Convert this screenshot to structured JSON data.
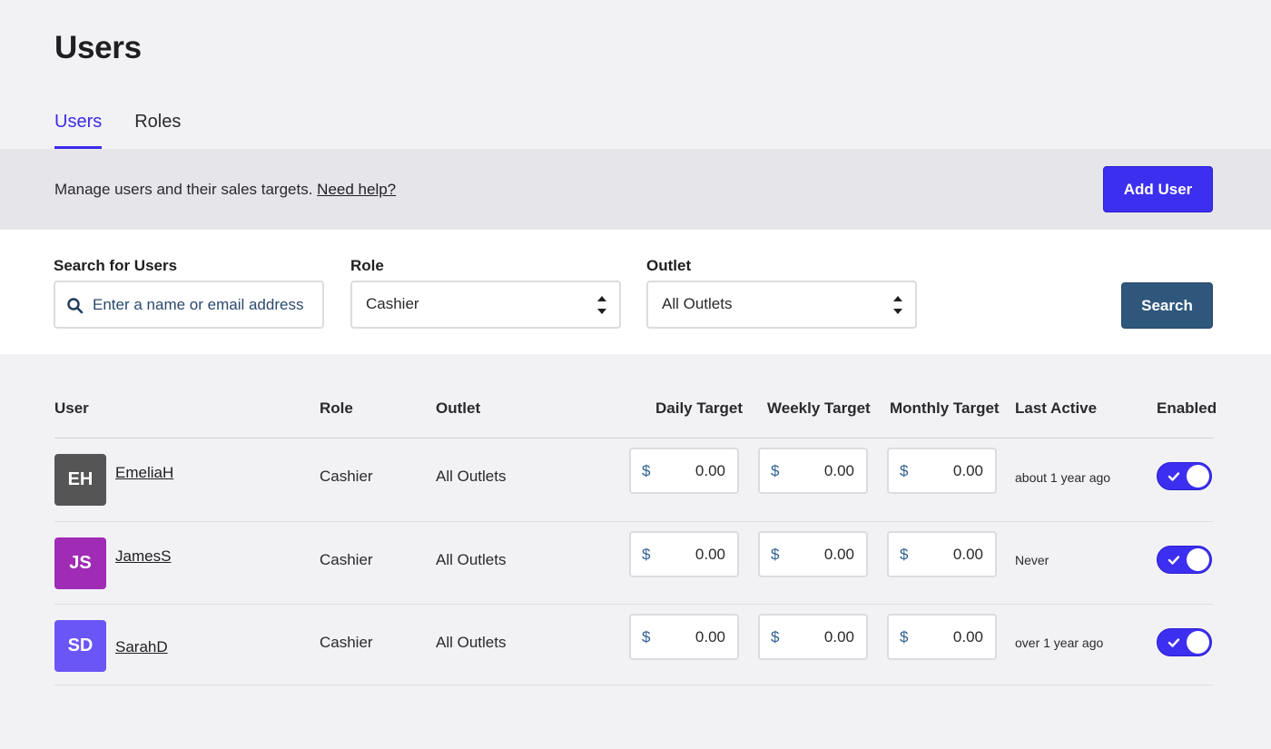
{
  "page": {
    "title": "Users"
  },
  "tabs": [
    {
      "label": "Users",
      "active": true
    },
    {
      "label": "Roles",
      "active": false
    }
  ],
  "banner": {
    "text": "Manage users and their sales targets.",
    "help_link": "Need help?",
    "add_button": "Add User"
  },
  "filters": {
    "search_label": "Search for Users",
    "search_placeholder": "Enter a name or email address",
    "role_label": "Role",
    "role_value": "Cashier",
    "outlet_label": "Outlet",
    "outlet_value": "All Outlets",
    "search_button": "Search"
  },
  "table": {
    "headers": {
      "user": "User",
      "role": "Role",
      "outlet": "Outlet",
      "daily": "Daily Target",
      "weekly": "Weekly Target",
      "monthly": "Monthly Target",
      "last_active": "Last Active",
      "enabled": "Enabled"
    },
    "currency": "$",
    "rows": [
      {
        "initials": "EH",
        "avatar_color": "#555555",
        "name": "EmeliaH",
        "role": "Cashier",
        "outlet": "All Outlets",
        "daily": "0.00",
        "weekly": "0.00",
        "monthly": "0.00",
        "last_active": "about 1 year ago",
        "enabled": true
      },
      {
        "initials": "JS",
        "avatar_color": "#a02bb5",
        "name": "JamesS",
        "role": "Cashier",
        "outlet": "All Outlets",
        "daily": "0.00",
        "weekly": "0.00",
        "monthly": "0.00",
        "last_active": "Never",
        "enabled": true
      },
      {
        "initials": "SD",
        "avatar_color": "#6a55f5",
        "name": "SarahD",
        "role": "Cashier",
        "outlet": "All Outlets",
        "daily": "0.00",
        "weekly": "0.00",
        "monthly": "0.00",
        "last_active": "over 1 year ago",
        "enabled": true
      }
    ]
  },
  "colors": {
    "accent": "#3d2ff0",
    "search_button": "#2f577c",
    "banner_bg": "#e6e5e9",
    "page_bg": "#f2f2f4"
  }
}
